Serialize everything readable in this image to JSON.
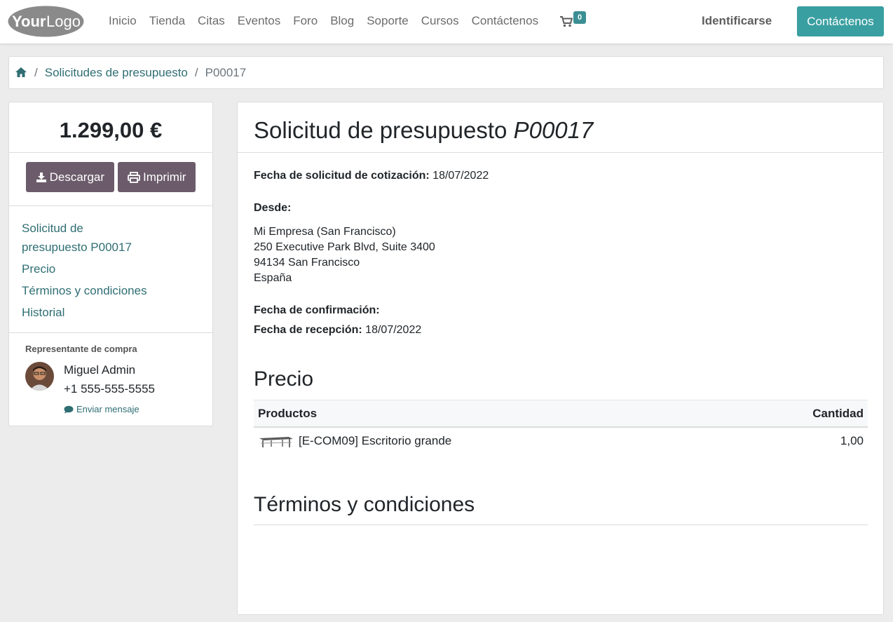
{
  "header": {
    "logo": "YourLogo",
    "nav": [
      "Inicio",
      "Tienda",
      "Citas",
      "Eventos",
      "Foro",
      "Blog",
      "Soporte",
      "Cursos",
      "Contáctenos"
    ],
    "cart_count": "0",
    "signin": "Identificarse",
    "contact_button": "Contáctenos",
    "accent": "#3a9fa1"
  },
  "breadcrumb": {
    "sep": "/",
    "link": "Solicitudes de presupuesto",
    "current": "P00017"
  },
  "sidebar": {
    "amount": "1.299,00 €",
    "download": "Descargar",
    "print": "Imprimir",
    "toc": [
      "Solicitud de presupuesto P00017",
      "Precio",
      "Términos y condiciones",
      "Historial"
    ],
    "rep_title": "Representante de compra",
    "rep_name": "Miguel Admin",
    "rep_phone": "+1 555-555-5555",
    "message": "Enviar mensaje"
  },
  "main": {
    "title_prefix": "Solicitud de presupuesto",
    "title_ref": "P00017",
    "request_date_label": "Fecha de solicitud de cotización:",
    "request_date": "18/07/2022",
    "from_label": "Desde:",
    "address": [
      "Mi Empresa (San Francisco)",
      "250 Executive Park Blvd, Suite 3400",
      "94134 San Francisco",
      "España"
    ],
    "confirm_label": "Fecha de confirmación:",
    "receipt_label": "Fecha de recepción:",
    "receipt_date": "18/07/2022",
    "price_title": "Precio",
    "table": {
      "col_product": "Productos",
      "col_qty": "Cantidad",
      "rows": [
        {
          "product": "[E-COM09] Escritorio grande",
          "qty": "1,00"
        }
      ]
    },
    "terms_title": "Términos y condiciones"
  }
}
